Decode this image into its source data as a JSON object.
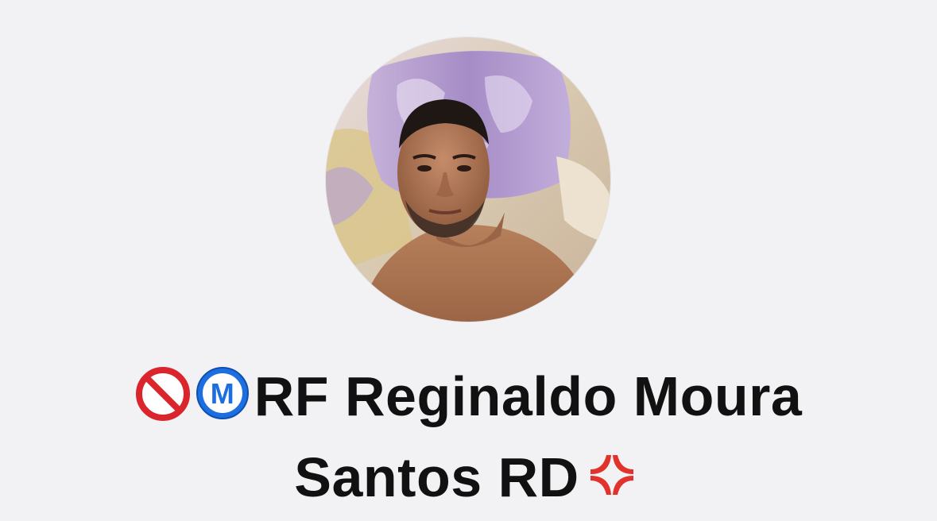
{
  "profile": {
    "avatar_icon": "profile-photo",
    "name_line1": "RF Reginaldo Moura",
    "name_line2": "Santos RD",
    "prefix_icons": [
      "prohibited-icon",
      "circled-m-icon"
    ],
    "suffix_icon": "anger-symbol-icon",
    "colors": {
      "background": "#f2f1f3",
      "name_text": "#111111",
      "prohibited_red": "#d9252b",
      "m_blue": "#1d6fe0",
      "anger_red": "#e2322c"
    }
  }
}
